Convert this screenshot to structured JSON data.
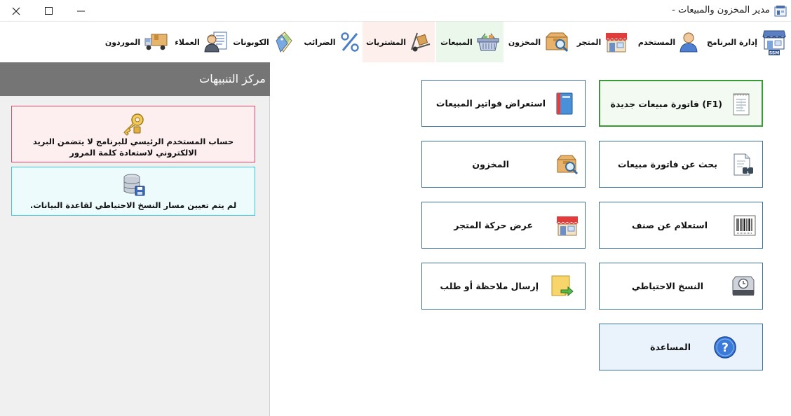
{
  "window": {
    "title": "مدير المخزون والمبيعات -"
  },
  "ribbon": {
    "items": [
      {
        "label": "إدارة البرنامج",
        "icon": "store-logo-icon",
        "badge": "SSM"
      },
      {
        "label": "المستخدم",
        "icon": "user-icon"
      },
      {
        "label": "المتجر",
        "icon": "shop-icon"
      },
      {
        "label": "المخزون",
        "icon": "inventory-box-icon"
      },
      {
        "label": "المبيعات",
        "icon": "basket-icon"
      },
      {
        "label": "المشتريات",
        "icon": "hand-truck-icon"
      },
      {
        "label": "الضرائب",
        "icon": "percent-icon"
      },
      {
        "label": "الكوبونات",
        "icon": "coupon-tag-icon"
      },
      {
        "label": "العملاء",
        "icon": "customer-icon"
      },
      {
        "label": "الموردون",
        "icon": "delivery-truck-icon"
      }
    ],
    "active_colors": {
      "sales": "#eaf7ea",
      "purchases": "#fdf0ec"
    }
  },
  "notifications": {
    "title": "مركز التنبيهات",
    "items": [
      {
        "text": "حساب المستخدم الرئيسي للبرنامج لا يتضمن البريد الالكتروني لاستعادة كلمة المرور",
        "icon": "key-icon"
      },
      {
        "text": "لم يتم تعيين مسار النسخ الاحتياطي لقاعدة البيانات.",
        "icon": "database-icon"
      }
    ]
  },
  "actions": {
    "new_invoice": "فاتورة مبيعات جديدة (F1)",
    "browse_invoices": "استعراض فواتير المبيعات",
    "search_invoice": "بحث عن فاتورة مبيعات",
    "inventory": "المخزون",
    "item_query": "استعلام عن صنف",
    "store_movement": "عرض حركة المتجر",
    "backup": "النسخ الاحتياطي",
    "send_note": "إرسال ملاحظة أو طلب",
    "help": "المساعدة"
  }
}
